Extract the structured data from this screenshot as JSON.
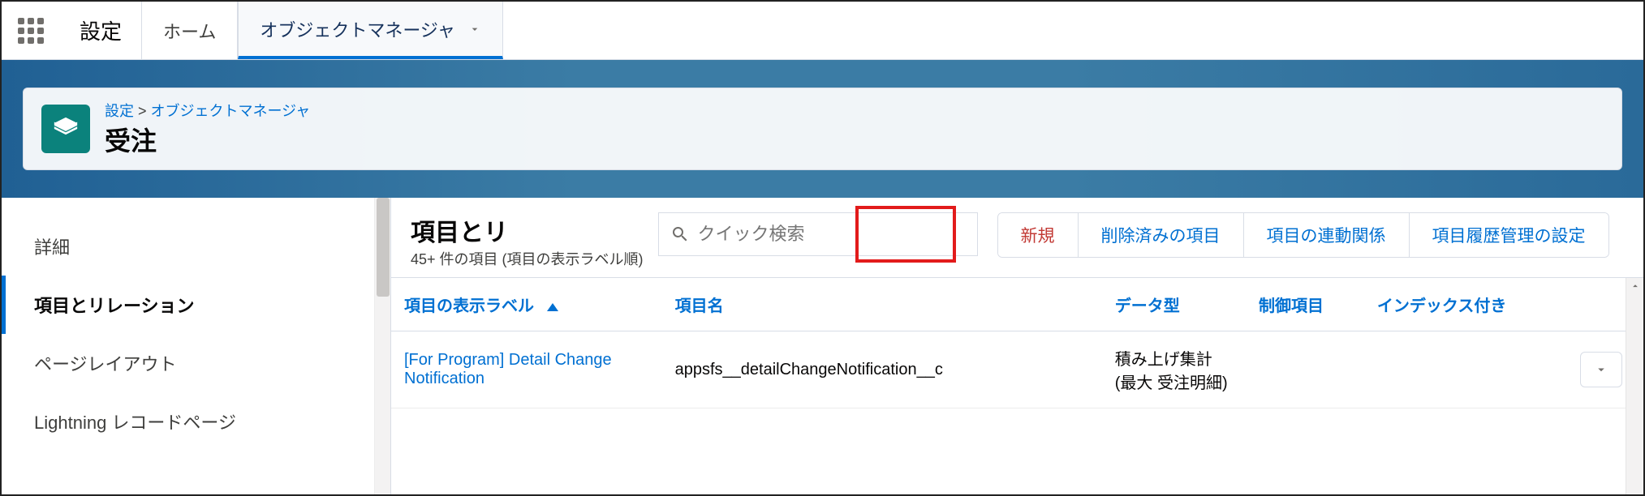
{
  "nav": {
    "app_name": "設定",
    "tab_home": "ホーム",
    "tab_obj_mgr": "オブジェクトマネージャ"
  },
  "breadcrumb": {
    "setup": "設定",
    "sep": " > ",
    "obj_mgr": "オブジェクトマネージャ"
  },
  "page_title": "受注",
  "sidebar": {
    "items": [
      "詳細",
      "項目とリレーション",
      "ページレイアウト",
      "Lightning レコードページ"
    ]
  },
  "main": {
    "title": "項目とリ",
    "sub": "45+ 件の項目 (項目の表示ラベル順)",
    "search_placeholder": "クイック検索",
    "buttons": {
      "new": "新規",
      "deleted": "削除済みの項目",
      "deps": "項目の連動関係",
      "history": "項目履歴管理の設定"
    }
  },
  "table": {
    "columns": {
      "label": "項目の表示ラベル",
      "api": "項目名",
      "type": "データ型",
      "controlling": "制御項目",
      "indexed": "インデックス付き"
    },
    "rows": [
      {
        "label": "[For Program] Detail Change Notification",
        "api": "appsfs__detailChangeNotification__c",
        "type": "積み上げ集計 (最大 受注明細)",
        "controlling": "",
        "indexed": ""
      }
    ]
  }
}
